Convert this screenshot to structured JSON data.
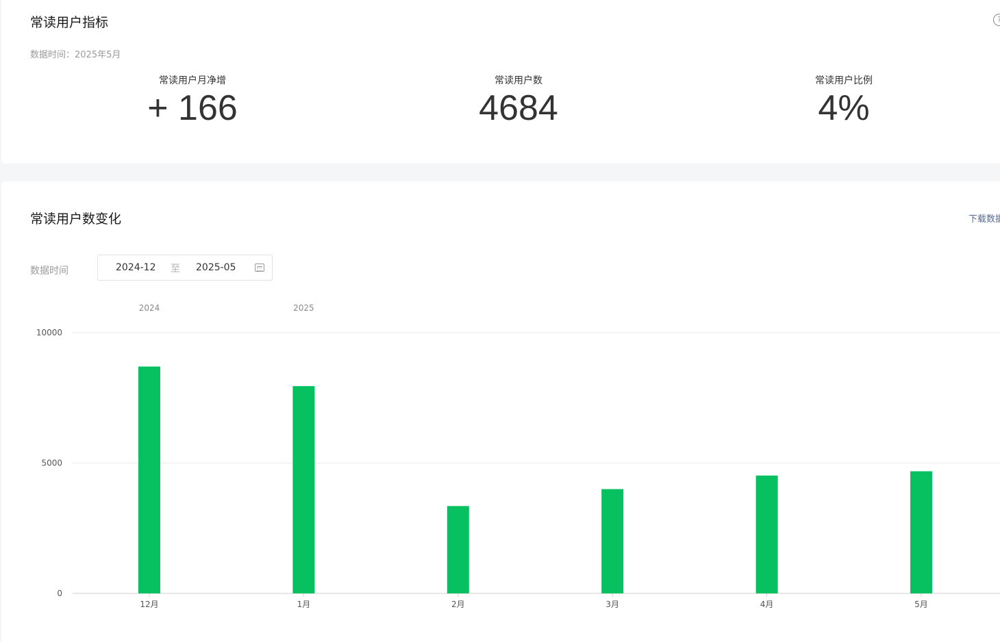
{
  "metrics_card": {
    "title": "常读用户指标",
    "help_icon": "?",
    "data_time_label": "数据时间：",
    "data_time_value": "2025年5月",
    "metrics": [
      {
        "label": "常读用户月净增",
        "value": "+ 166"
      },
      {
        "label": "常读用户数",
        "value": "4684"
      },
      {
        "label": "常读用户比例",
        "value": "4%"
      }
    ]
  },
  "trend_card": {
    "title": "常读用户数变化",
    "download_label": "下载数据",
    "filter_label": "数据时间",
    "range": {
      "start": "2024-12",
      "separator": "至",
      "end": "2025-05"
    }
  },
  "colors": {
    "bar": "#07c160",
    "grid": "#e9e9e9",
    "link": "#576b95"
  },
  "chart_data": {
    "type": "bar",
    "categories": [
      "12月",
      "1月",
      "2月",
      "3月",
      "4月",
      "5月"
    ],
    "year_labels": [
      {
        "text": "2024",
        "index": 0
      },
      {
        "text": "2025",
        "index": 1
      }
    ],
    "values": [
      8700,
      7950,
      3350,
      4000,
      4520,
      4684
    ],
    "ylim": [
      0,
      10000
    ],
    "yticks": [
      0,
      5000,
      10000
    ],
    "grid": true,
    "title": "",
    "xlabel": "",
    "ylabel": ""
  }
}
